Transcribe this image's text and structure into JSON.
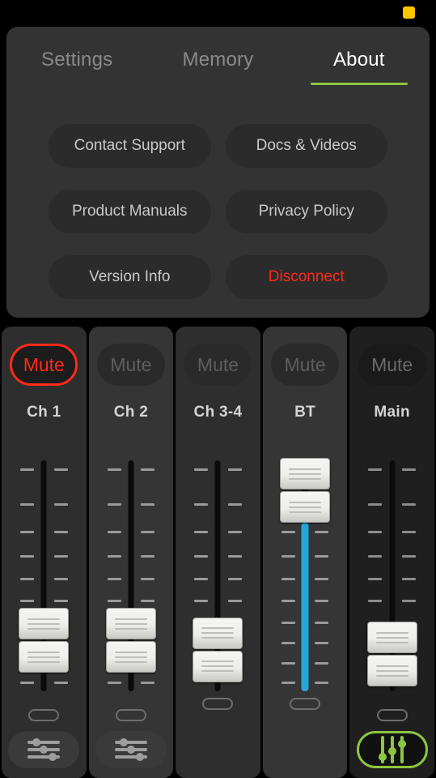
{
  "status": {
    "indicator_name": "connection-status-indicator",
    "indicator_color": "#FFC400"
  },
  "panel": {
    "tabs": [
      {
        "label": "Settings",
        "active": false
      },
      {
        "label": "Memory",
        "active": false
      },
      {
        "label": "About",
        "active": true
      }
    ],
    "active_tab": "About",
    "accent_color": "#8DC63F",
    "buttons": [
      {
        "label": "Contact Support",
        "style": "normal"
      },
      {
        "label": "Docs & Videos",
        "style": "normal"
      },
      {
        "label": "Product Manuals",
        "style": "normal"
      },
      {
        "label": "Privacy Policy",
        "style": "normal"
      },
      {
        "label": "Version Info",
        "style": "normal"
      },
      {
        "label": "Disconnect",
        "style": "danger"
      }
    ],
    "danger_color": "#FF2A18"
  },
  "mixer": {
    "mute_label": "Mute",
    "fader_fill_color": "#25A7DC",
    "channels": [
      {
        "name": "Ch 1",
        "mute_label": "Mute",
        "muted": true,
        "fader_percent": 22,
        "has_eq_button": true,
        "eq_icon": "horizontal-sliders-icon",
        "eq_accent": false,
        "fill_visible": false,
        "strip_shade": "normal"
      },
      {
        "name": "Ch 2",
        "mute_label": "Mute",
        "muted": false,
        "fader_percent": 22,
        "has_eq_button": true,
        "eq_icon": "horizontal-sliders-icon",
        "eq_accent": false,
        "fill_visible": false,
        "strip_shade": "alt"
      },
      {
        "name": "Ch 3-4",
        "mute_label": "Mute",
        "muted": false,
        "fader_percent": 18,
        "has_eq_button": false,
        "eq_icon": "",
        "eq_accent": false,
        "fill_visible": false,
        "strip_shade": "normal"
      },
      {
        "name": "BT",
        "mute_label": "Mute",
        "muted": false,
        "fader_percent": 87,
        "has_eq_button": false,
        "eq_icon": "",
        "eq_accent": false,
        "fill_visible": true,
        "strip_shade": "alt"
      },
      {
        "name": "Main",
        "mute_label": "Mute",
        "muted": false,
        "fader_percent": 16,
        "has_eq_button": true,
        "eq_icon": "vertical-sliders-icon",
        "eq_accent": true,
        "fill_visible": false,
        "strip_shade": "dark"
      }
    ]
  }
}
